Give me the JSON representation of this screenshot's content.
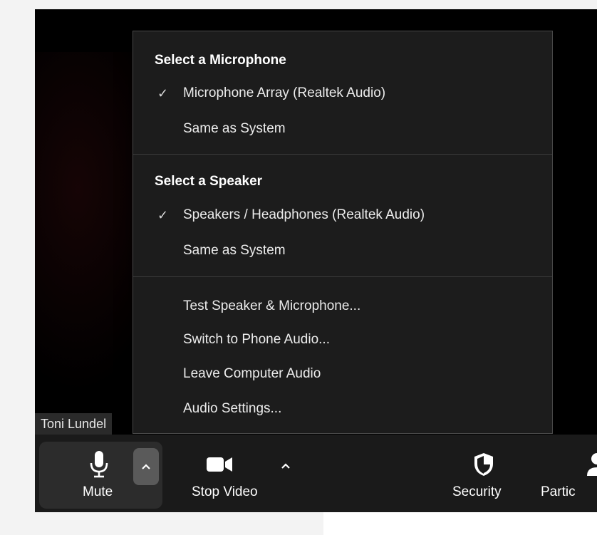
{
  "participant": {
    "name": "Toni Lundel"
  },
  "audio_menu": {
    "microphone_section": {
      "heading": "Select a Microphone",
      "items": [
        {
          "label": "Microphone Array (Realtek Audio)",
          "checked": true
        },
        {
          "label": "Same as System",
          "checked": false
        }
      ]
    },
    "speaker_section": {
      "heading": "Select a Speaker",
      "items": [
        {
          "label": "Speakers / Headphones (Realtek Audio)",
          "checked": true
        },
        {
          "label": "Same as System",
          "checked": false
        }
      ]
    },
    "actions": [
      {
        "label": "Test Speaker & Microphone..."
      },
      {
        "label": "Switch to Phone Audio..."
      },
      {
        "label": "Leave Computer Audio"
      },
      {
        "label": "Audio Settings..."
      }
    ],
    "check_glyph": "✓"
  },
  "toolbar": {
    "mute": {
      "label": "Mute",
      "icon": "microphone-icon"
    },
    "video": {
      "label": "Stop Video",
      "icon": "video-camera-icon"
    },
    "security": {
      "label": "Security",
      "icon": "shield-icon"
    },
    "participants": {
      "label": "Partic",
      "icon": "participants-icon"
    },
    "caret_glyph": "^"
  }
}
